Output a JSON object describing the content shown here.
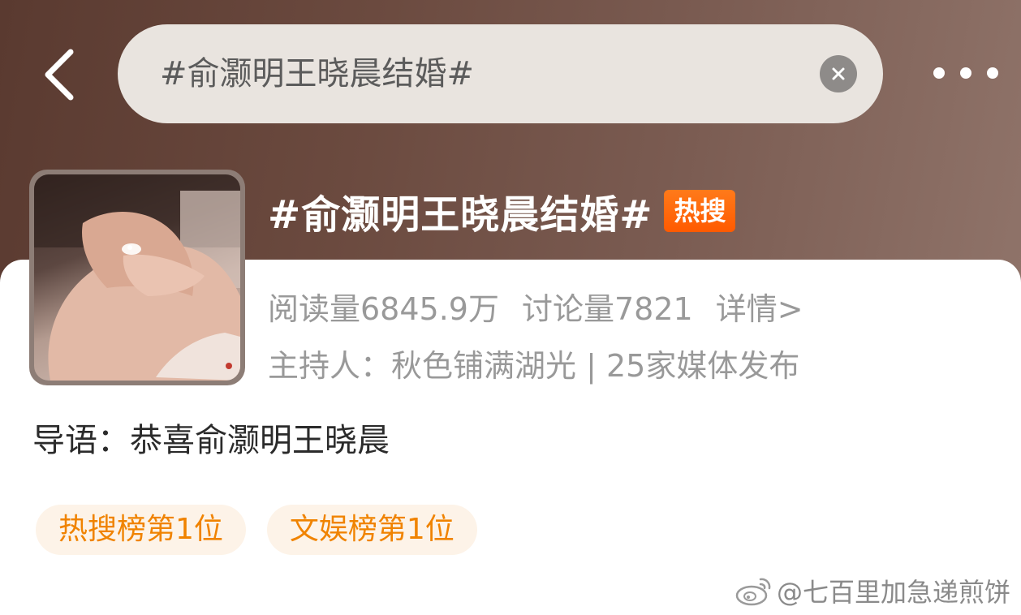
{
  "header": {
    "back_icon": "chevron-left-icon",
    "search_query": "#俞灏明王晓晨结婚#",
    "clear_icon": "close-circle-icon",
    "more_icon": "more-horizontal-icon"
  },
  "topic": {
    "title": "#俞灏明王晓晨结婚#",
    "badge": "热搜",
    "stats": {
      "reads": "阅读量6845.9万",
      "discussions": "讨论量7821",
      "details": "详情>"
    },
    "host_line": "主持人：秋色铺满湖光 | 25家媒体发布",
    "intro": "导语：恭喜俞灏明王晓晨"
  },
  "tags": [
    {
      "label": "热搜榜第1位"
    },
    {
      "label": "文娱榜第1位"
    }
  ],
  "watermark": "@七百里加急递煎饼",
  "colors": {
    "badge": "#ff5a00",
    "tag_text": "#f08300",
    "tag_bg": "#fdf3e8",
    "secondary_text": "#999999"
  }
}
